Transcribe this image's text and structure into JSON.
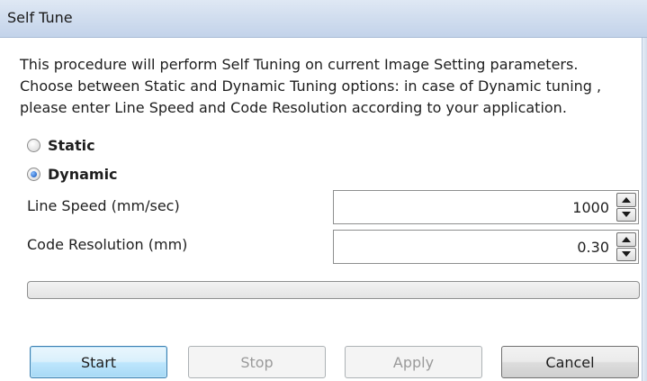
{
  "window": {
    "title": "Self Tune"
  },
  "description": {
    "lines": [
      "This procedure will perform Self Tuning on current Image Setting parameters.",
      "Choose between Static and Dynamic Tuning options: in case of Dynamic tuning ,",
      "please enter Line Speed and Code Resolution according to your application."
    ]
  },
  "tuning_mode": {
    "options": [
      {
        "label": "Static",
        "selected": false
      },
      {
        "label": "Dynamic",
        "selected": true
      }
    ]
  },
  "fields": {
    "line_speed": {
      "label": "Line Speed (mm/sec)",
      "value": "1000"
    },
    "code_resolution": {
      "label": "Code Resolution (mm)",
      "value": "0.30"
    }
  },
  "progress": {
    "value": 0
  },
  "buttons": {
    "start": {
      "label": "Start",
      "enabled": true
    },
    "stop": {
      "label": "Stop",
      "enabled": false
    },
    "apply": {
      "label": "Apply",
      "enabled": false
    },
    "cancel": {
      "label": "Cancel",
      "enabled": true
    }
  },
  "colors": {
    "accent": "#3c7fb1",
    "titlebar": "#cfdcee"
  }
}
